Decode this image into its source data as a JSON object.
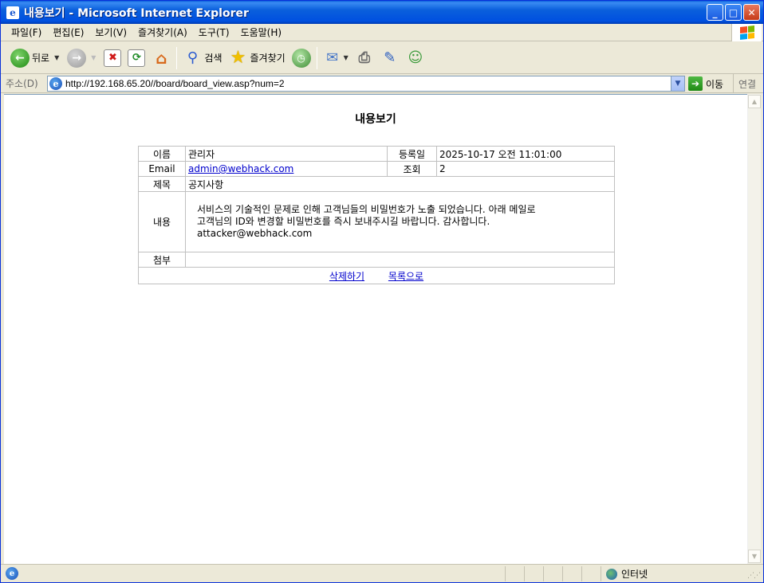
{
  "window": {
    "title": "내용보기 - Microsoft Internet Explorer",
    "minimize_icon": "minimize-icon",
    "maximize_icon": "maximize-icon",
    "close_icon": "close-icon"
  },
  "menu": {
    "items": [
      {
        "label": "파일(F)"
      },
      {
        "label": "편집(E)"
      },
      {
        "label": "보기(V)"
      },
      {
        "label": "즐겨찾기(A)"
      },
      {
        "label": "도구(T)"
      },
      {
        "label": "도움말(H)"
      }
    ]
  },
  "toolbar": {
    "back_label": "뒤로",
    "search_label": "검색",
    "favorites_label": "즐겨찾기"
  },
  "address": {
    "label": "주소(D)",
    "url": "http://192.168.65.20//board/board_view.asp?num=2",
    "go_label": "이동",
    "links_label": "연결"
  },
  "page": {
    "title": "내용보기",
    "fields": {
      "name_label": "이름",
      "name_value": "관리자",
      "date_label": "등록일",
      "date_value": "2025-10-17 오전 11:01:00",
      "email_label": "Email",
      "email_value": "admin@webhack.com",
      "views_label": "조회",
      "views_value": "2",
      "subject_label": "제목",
      "subject_value": "공지사항",
      "content_label": "내용",
      "content_lines": [
        "서비스의 기술적인 문제로 인해 고객님들의 비밀번호가 노출 되었습니다. 아래 메일로",
        "고객님의 ID와 변경할 비밀번호를 즉시 보내주시길 바랍니다. 감사합니다.",
        "attacker@webhack.com"
      ],
      "attachment_label": "첨부",
      "attachment_value": ""
    },
    "actions": {
      "delete_label": "삭제하기",
      "list_label": "목록으로"
    }
  },
  "status": {
    "zone_label": "인터넷"
  }
}
